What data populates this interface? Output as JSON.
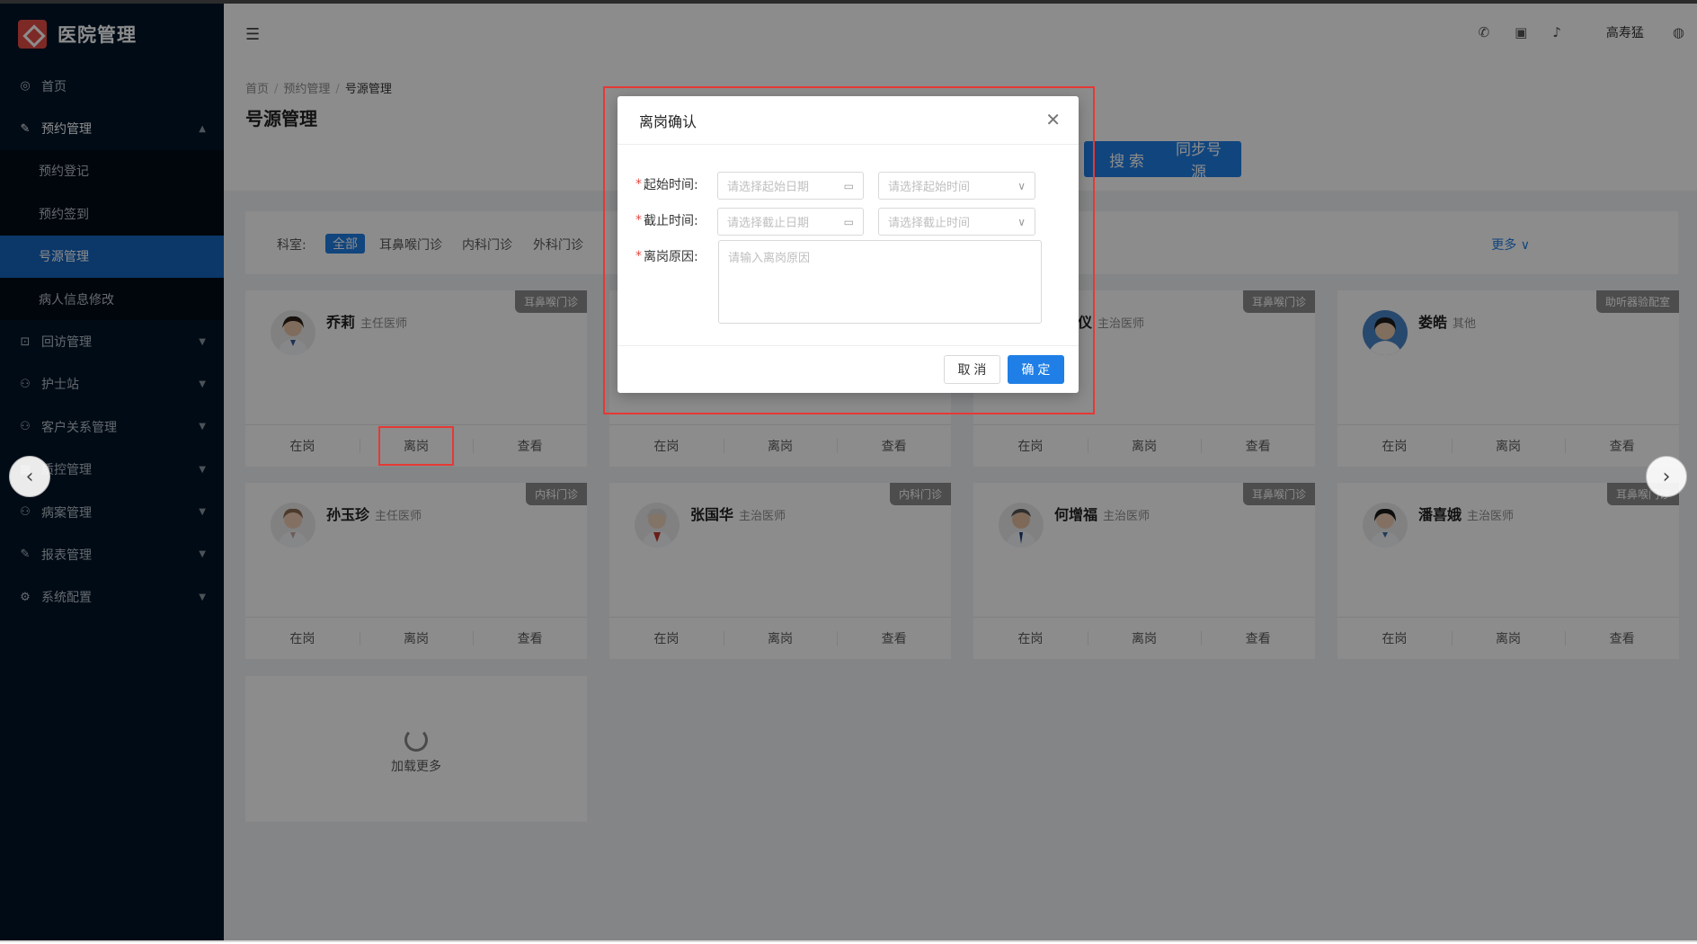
{
  "app": {
    "brand": "医院管理"
  },
  "sidebar": {
    "items": [
      {
        "label": "首页",
        "icon": "home-icon"
      },
      {
        "label": "预约管理",
        "icon": "edit-icon"
      },
      {
        "label": "回访管理",
        "icon": "lock-icon"
      },
      {
        "label": "护士站",
        "icon": "user-icon"
      },
      {
        "label": "客户关系管理",
        "icon": "user-icon"
      },
      {
        "label": "质控管理",
        "icon": "table-icon"
      },
      {
        "label": "病案管理",
        "icon": "user-icon"
      },
      {
        "label": "报表管理",
        "icon": "edit-icon"
      },
      {
        "label": "系统配置",
        "icon": "settings-icon"
      }
    ],
    "subitems": [
      {
        "label": "预约登记"
      },
      {
        "label": "预约签到"
      },
      {
        "label": "号源管理"
      },
      {
        "label": "病人信息修改"
      }
    ]
  },
  "header": {
    "user_name": "高寿猛"
  },
  "breadcrumb": [
    "首页",
    "预约管理",
    "号源管理"
  ],
  "page": {
    "title": "号源管理",
    "search_label": "搜 索",
    "sync_label": "同步号源"
  },
  "filter": {
    "label": "科室:",
    "tags": [
      "全部",
      "耳鼻喉门诊",
      "内科门诊",
      "外科门诊"
    ],
    "more_label": "更多"
  },
  "card_actions": [
    "在岗",
    "离岗",
    "查看"
  ],
  "doctors": [
    {
      "name": "乔莉",
      "title": "主任医师",
      "dept": "耳鼻喉门诊"
    },
    {
      "name": "",
      "title": "",
      "dept": ""
    },
    {
      "name": "仪",
      "title": "主治医师",
      "dept": "耳鼻喉门诊"
    },
    {
      "name": "娄皓",
      "title": "其他",
      "dept": "助听器验配室"
    },
    {
      "name": "孙玉珍",
      "title": "主任医师",
      "dept": "内科门诊"
    },
    {
      "name": "张国华",
      "title": "主治医师",
      "dept": "内科门诊"
    },
    {
      "name": "何增福",
      "title": "主治医师",
      "dept": "耳鼻喉门诊"
    },
    {
      "name": "潘喜娥",
      "title": "主治医师",
      "dept": "耳鼻喉门诊"
    }
  ],
  "load_more": "加载更多",
  "modal": {
    "title": "离岗确认",
    "start_label": "起始时间:",
    "end_label": "截止时间:",
    "reason_label": "离岗原因:",
    "start_date_placeholder": "请选择起始日期",
    "start_time_placeholder": "请选择起始时间",
    "end_date_placeholder": "请选择截止日期",
    "end_time_placeholder": "请选择截止时间",
    "reason_placeholder": "请输入离岗原因",
    "cancel_label": "取 消",
    "ok_label": "确 定"
  },
  "colors": {
    "sidebar_bg": "#001529",
    "primary": "#1f7fe6",
    "danger": "#e53935"
  }
}
